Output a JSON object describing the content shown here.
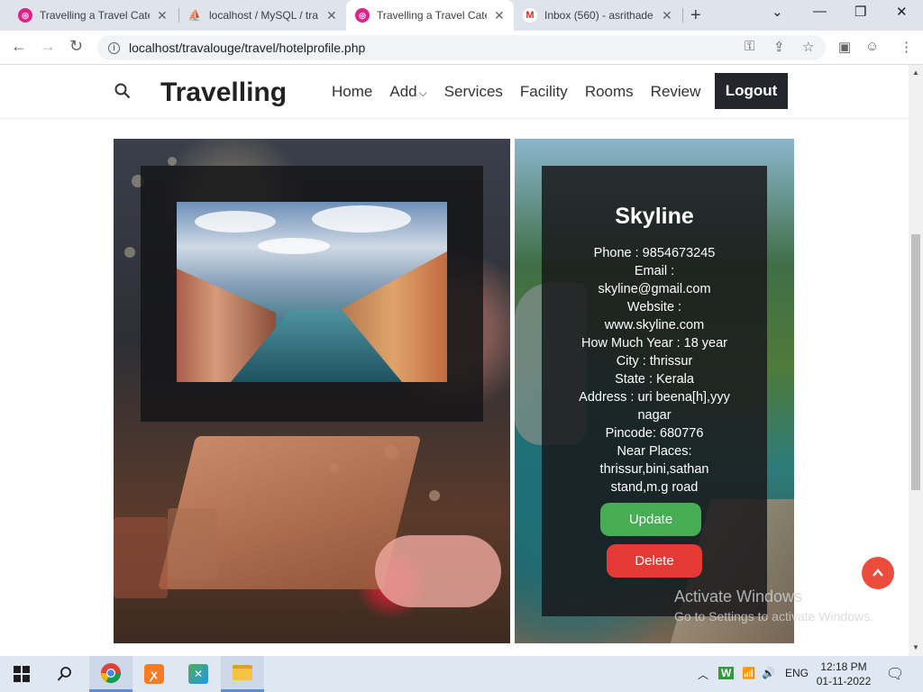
{
  "browser": {
    "tabs": [
      {
        "title": "Travelling a Travel Cate",
        "active": false
      },
      {
        "title": "localhost / MySQL / tra",
        "active": false
      },
      {
        "title": "Travelling a Travel Cate",
        "active": true
      },
      {
        "title": "Inbox (560) - asrithade",
        "active": false
      }
    ],
    "url": "localhost/travalouge/travel/hotelprofile.php"
  },
  "site": {
    "brand": "Travelling",
    "nav": [
      "Home",
      "Add",
      "Services",
      "Facility",
      "Rooms",
      "Review"
    ],
    "logout_label": "Logout"
  },
  "hotel": {
    "name": "Skyline",
    "lines": [
      "Phone : 9854673245",
      "Email :",
      "skyline@gmail.com",
      "Website :",
      "www.skyline.com",
      "How Much Year : 18 year",
      "City : thrissur",
      "State : Kerala",
      "Address : uri beena[h],yyy",
      "nagar",
      "Pincode: 680776",
      "Near Places:",
      "thrissur,bini,sathan",
      "stand,m.g road"
    ],
    "update_label": "Update",
    "delete_label": "Delete"
  },
  "watermark": {
    "line1": "Activate Windows",
    "line2": "Go to Settings to activate Windows."
  },
  "taskbar": {
    "lang": "ENG",
    "time": "12:18 PM",
    "date": "01-11-2022"
  },
  "colors": {
    "update": "#46ad54",
    "delete": "#e53935",
    "logout": "#23262d",
    "back_to_top": "#ec4c3c"
  }
}
